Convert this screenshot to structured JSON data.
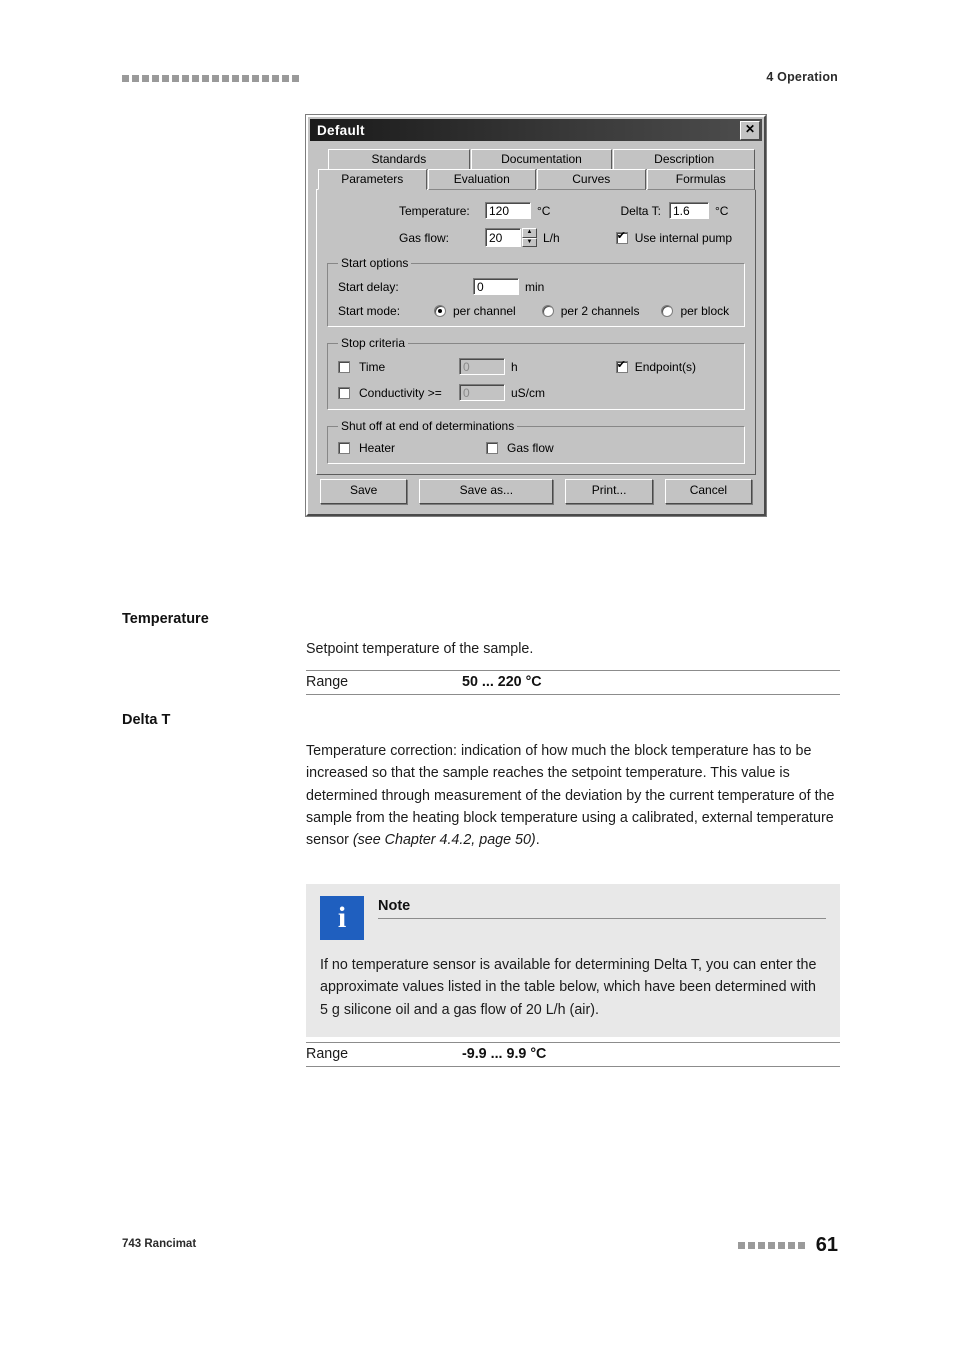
{
  "header": {
    "chapter": "4 Operation"
  },
  "dialog": {
    "title": "Default",
    "close_label": "✕",
    "tabs_row1": [
      {
        "label": "Standards",
        "active": false
      },
      {
        "label": "Documentation",
        "active": false
      },
      {
        "label": "Description",
        "active": false
      }
    ],
    "tabs_row2": [
      {
        "label": "Parameters",
        "active": true
      },
      {
        "label": "Evaluation",
        "active": false
      },
      {
        "label": "Curves",
        "active": false
      },
      {
        "label": "Formulas",
        "active": false
      }
    ],
    "temperature_label": "Temperature:",
    "temperature_value": "120",
    "temperature_unit": "°C",
    "delta_t_label": "Delta T:",
    "delta_t_value": "1.6",
    "delta_t_unit": "°C",
    "gas_flow_label": "Gas flow:",
    "gas_flow_value": "20",
    "gas_flow_unit": "L/h",
    "use_internal_pump_label": "Use internal pump",
    "use_internal_pump_checked": true,
    "start_options_legend": "Start options",
    "start_delay_label": "Start delay:",
    "start_delay_value": "0",
    "start_delay_unit": "min",
    "start_mode_label": "Start mode:",
    "start_mode_options": [
      {
        "label": "per channel",
        "selected": true
      },
      {
        "label": "per 2 channels",
        "selected": false
      },
      {
        "label": "per block",
        "selected": false
      }
    ],
    "stop_criteria_legend": "Stop criteria",
    "time_label": "Time",
    "time_checked": false,
    "time_value": "0",
    "time_unit": "h",
    "conductivity_label": "Conductivity  >=",
    "conductivity_checked": false,
    "conductivity_value": "0",
    "conductivity_unit": "uS/cm",
    "endpoints_label": "Endpoint(s)",
    "endpoints_checked": true,
    "shutoff_legend": "Shut off at end of determinations",
    "heater_label": "Heater",
    "heater_checked": false,
    "shut_gas_flow_label": "Gas flow",
    "shut_gas_flow_checked": false,
    "buttons": [
      {
        "label": "Save"
      },
      {
        "label": "Save as..."
      },
      {
        "label": "Print..."
      },
      {
        "label": "Cancel"
      }
    ]
  },
  "sections": {
    "temperature_heading": "Temperature",
    "temperature_desc": "Setpoint temperature of the sample.",
    "temperature_range_key": "Range",
    "temperature_range_value": "50 ... 220 °C",
    "delta_t_heading": "Delta T",
    "delta_t_desc_part1": "Temperature correction: indication of how much the block temperature has to be increased so that the sample reaches the setpoint temperature. This value is determined through measurement of the deviation by the current temperature of the sample from the heating block temperature using a calibrated, external temperature sensor ",
    "delta_t_desc_italic": "(see Chapter 4.4.2, page 50)",
    "delta_t_desc_end": ".",
    "delta_t_range_key": "Range",
    "delta_t_range_value": "-9.9 ... 9.9 °C"
  },
  "note": {
    "icon_glyph": "i",
    "title": "Note",
    "text": "If no temperature sensor is available for determining Delta T, you can enter the approximate values listed in the table below, which have been determined with 5 g silicone oil and a gas flow of 20 L/h (air)."
  },
  "footer": {
    "left": "743 Rancimat",
    "page_number": "61"
  }
}
